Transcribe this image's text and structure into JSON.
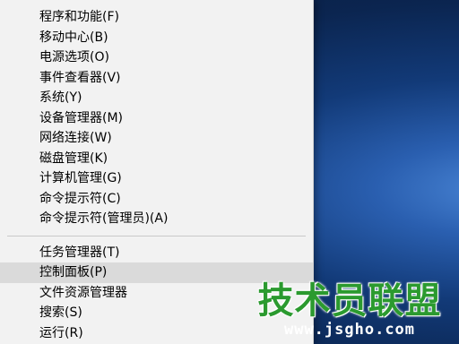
{
  "menu": {
    "group1": [
      "程序和功能(F)",
      "移动中心(B)",
      "电源选项(O)",
      "事件查看器(V)",
      "系统(Y)",
      "设备管理器(M)",
      "网络连接(W)",
      "磁盘管理(K)",
      "计算机管理(G)",
      "命令提示符(C)",
      "命令提示符(管理员)(A)"
    ],
    "group2": [
      "任务管理器(T)",
      "控制面板(P)",
      "文件资源管理器",
      "搜索(S)",
      "运行(R)"
    ],
    "highlighted": "控制面板(P)"
  },
  "watermark": {
    "title": "技术员联盟",
    "url": "www.jsgho.com"
  },
  "colors": {
    "menu_bg": "#f2f2f2",
    "highlight_bg": "#dadada",
    "watermark_green": "#2b9a2f",
    "desktop_blue": "#0b2550"
  }
}
